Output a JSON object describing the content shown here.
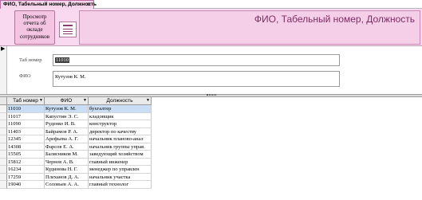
{
  "tab": {
    "title": "ФИО, Табельный номер, Должность",
    "close_glyph": "×"
  },
  "header": {
    "report_button_label": "Просмотр отчета об окладе сотрудников",
    "form_icon": "form-icon",
    "title": "ФИО, Табельный номер, Должность"
  },
  "form": {
    "record_indicator": "▶",
    "tab_number_label": "Таб номер",
    "tab_number_value": "11010",
    "fio_label": "ФИО",
    "fio_value": "Кутузов К. М."
  },
  "datasheet": {
    "columns": [
      "Таб номер",
      "ФИО",
      "Должность"
    ],
    "rows": [
      {
        "num": "11010",
        "fio": "Кутузов К. М.",
        "pos": "бухгалтер"
      },
      {
        "num": "11017",
        "fio": "Капустин Э. С.",
        "pos": "кладовщик"
      },
      {
        "num": "11090",
        "fio": "Руденко И. В.",
        "pos": "конструктор"
      },
      {
        "num": "11403",
        "fio": "Байрамов Р. А.",
        "pos": "директор по качеству"
      },
      {
        "num": "12345",
        "fio": "Арефьева А. Г.",
        "pos": "начальник планово-анал"
      },
      {
        "num": "14308",
        "fio": "Фарсов Е. А.",
        "pos": "начальник группы управ."
      },
      {
        "num": "15505",
        "fio": "Балясников М.",
        "pos": "заведующий хозяйством"
      },
      {
        "num": "15812",
        "fio": "Чернов А. В.",
        "pos": "главный инженер"
      },
      {
        "num": "16234",
        "fio": "Кудинова Н. Г.",
        "pos": "менеджер по управлен"
      },
      {
        "num": "17259",
        "fio": "Плеханов Д. А.",
        "pos": "начальник участка"
      },
      {
        "num": "19040",
        "fio": "Соловьев А. А.",
        "pos": "главный технолог"
      }
    ]
  },
  "colors": {
    "header_bg": "#f9d9ef",
    "title_text": "#7c2c63",
    "selected_row": "#c9def5"
  }
}
